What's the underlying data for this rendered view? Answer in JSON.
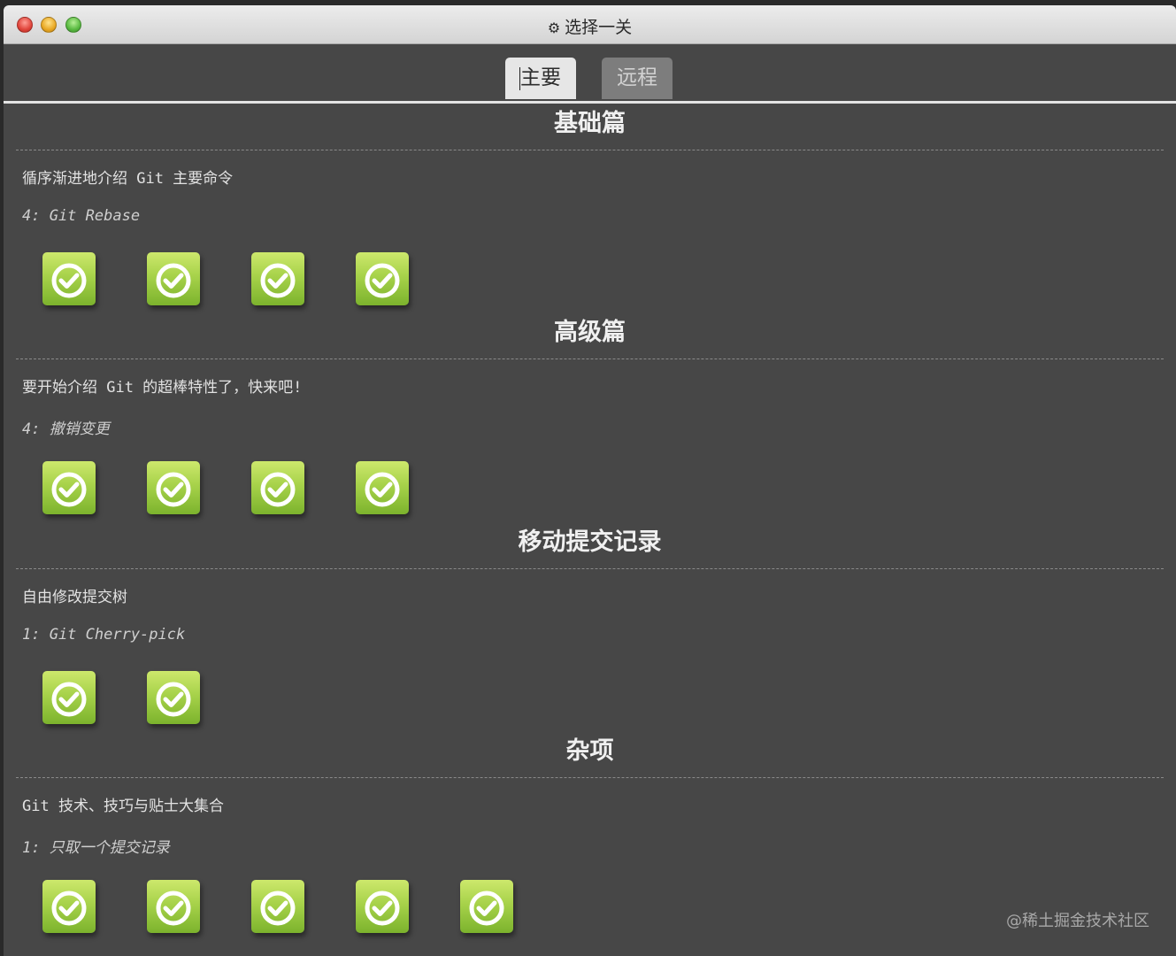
{
  "window": {
    "title": "选择一关",
    "title_icon": "gear-icon"
  },
  "tabs": [
    {
      "label": "主要",
      "active": true
    },
    {
      "label": "远程",
      "active": false
    }
  ],
  "sections": [
    {
      "title": "基础篇",
      "description": "循序渐进地介绍 Git 主要命令",
      "current_level": "4: Git Rebase",
      "levels_completed": 4
    },
    {
      "title": "高级篇",
      "description": "要开始介绍 Git 的超棒特性了，快来吧!",
      "current_level": "4: 撤销变更",
      "levels_completed": 4
    },
    {
      "title": "移动提交记录",
      "description": "自由修改提交树",
      "current_level": "1: Git Cherry-pick",
      "levels_completed": 2
    },
    {
      "title": "杂项",
      "description": "Git 技术、技巧与贴士大集合",
      "current_level": "1: 只取一个提交记录",
      "levels_completed": 5
    }
  ],
  "level_icon": "check-circle-icon",
  "colors": {
    "background": "#474747",
    "level_green": "#a7d24a",
    "tab_active": "#e6e6e6",
    "tab_inactive": "#7d7d7d"
  },
  "watermark": "@稀土掘金技术社区"
}
